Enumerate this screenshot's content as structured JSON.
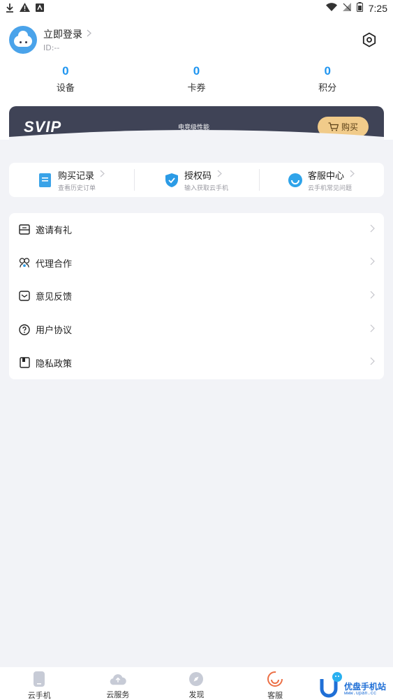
{
  "status_bar": {
    "time": "7:25"
  },
  "profile": {
    "login_label": "立即登录",
    "id_label": "ID:--"
  },
  "stats": [
    {
      "value": "0",
      "label": "设备"
    },
    {
      "value": "0",
      "label": "卡券"
    },
    {
      "value": "0",
      "label": "积分"
    }
  ],
  "svip": {
    "logo": "SVIP",
    "subtitle": "电竞级性能",
    "buy_label": "购买"
  },
  "quick_links": [
    {
      "title": "购买记录",
      "subtitle": "查看历史订单",
      "icon": "document-icon"
    },
    {
      "title": "授权码",
      "subtitle": "输入获取云手机",
      "icon": "shield-check-icon"
    },
    {
      "title": "客服中心",
      "subtitle": "云手机常见问题",
      "icon": "headset-icon"
    }
  ],
  "menu": [
    {
      "label": "邀请有礼",
      "icon": "gift-icon"
    },
    {
      "label": "代理合作",
      "icon": "partners-icon"
    },
    {
      "label": "意见反馈",
      "icon": "envelope-icon"
    },
    {
      "label": "用户协议",
      "icon": "question-icon"
    },
    {
      "label": "隐私政策",
      "icon": "document-icon"
    }
  ],
  "bottom_nav": [
    {
      "label": "云手机",
      "icon": "phone-icon"
    },
    {
      "label": "云服务",
      "icon": "cloud-icon"
    },
    {
      "label": "发现",
      "icon": "compass-icon"
    },
    {
      "label": "客服",
      "icon": "smile-service-icon"
    }
  ],
  "watermark": {
    "text": "优盘手机站",
    "url": "www.upan.cc"
  },
  "colors": {
    "accent": "#1f95f0",
    "svip_bg": "#3f4356",
    "buy_btn": "#f1cb8a",
    "page_bg": "#f2f3f7"
  }
}
